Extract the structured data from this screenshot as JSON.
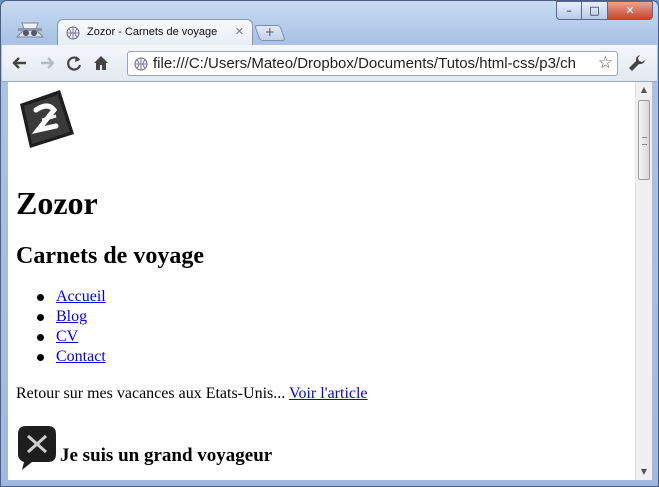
{
  "browser": {
    "tab_title": "Zozor - Carnets de voyage",
    "tab_close": "✕",
    "new_tab": "+",
    "address": "file:///C:/Users/Mateo/Dropbox/Documents/Tutos/html-css/p3/ch",
    "window_buttons": {
      "minimize": "–",
      "maximize": "□",
      "close": "✕"
    },
    "icons": {
      "back": "back-arrow-icon",
      "forward": "forward-arrow-icon",
      "reload": "reload-icon",
      "home": "home-icon",
      "star": "star-icon",
      "wrench": "wrench-icon"
    }
  },
  "page": {
    "site_title": "Zozor",
    "subtitle": "Carnets de voyage",
    "nav": [
      "Accueil",
      "Blog",
      "CV",
      "Contact"
    ],
    "intro_text": "Retour sur mes vacances aux Etats-Unis... ",
    "intro_link": "Voir l'article ",
    "section_heading": "Je suis un grand voyageur"
  },
  "colors": {
    "link": "#0000ee",
    "window_frame": "#9fb9e0"
  }
}
